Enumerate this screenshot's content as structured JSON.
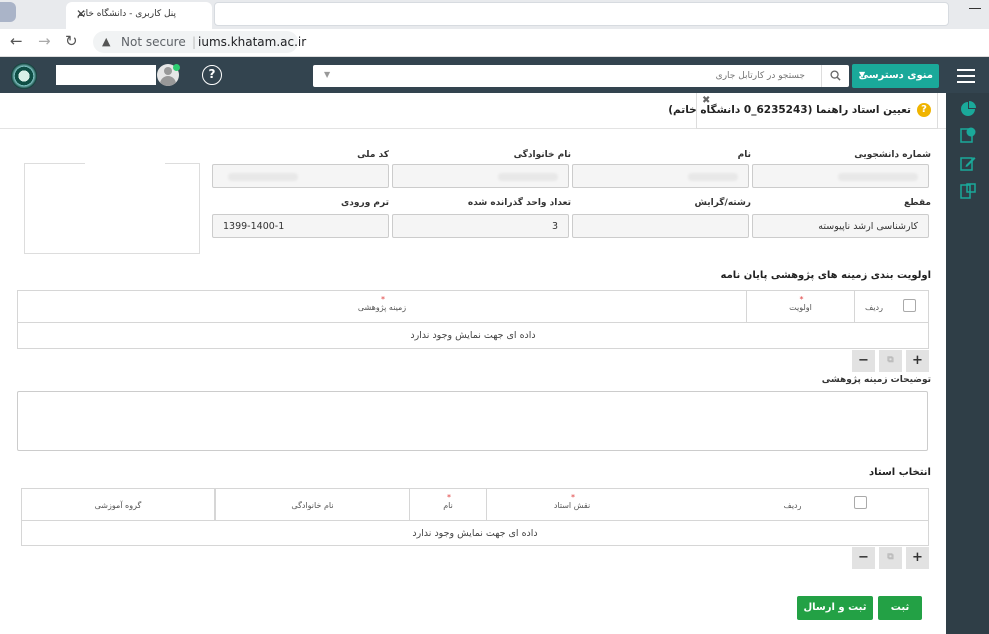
{
  "browser": {
    "tab_title": "پنل کاربری - دانشگاه خاتم",
    "tab_close": "✕",
    "not_secure": "Not secure",
    "url": "iums.khatam.ac.ir",
    "back": "←",
    "forward": "→",
    "reload": "↻",
    "menu": "⋮"
  },
  "header": {
    "search_placeholder": "جستجو در کارتابل جاری",
    "access_menu_label": "منوی دسترسی",
    "help": "?",
    "accent_color": "#1aa99a",
    "bar_color": "#33444f"
  },
  "page_tab": {
    "title": "تعیین استاد راهنما (6235243_0 دانشگاه خاتم)",
    "help": "?",
    "close": "✖"
  },
  "form": {
    "student_number_label": "شماره دانشجویی",
    "first_name_label": "نام",
    "last_name_label": "نام خانوادگی",
    "national_id_label": "کد ملی",
    "degree_label": "مقطع",
    "degree_value": "کارشناسی ارشد ناپیوسته",
    "field_label": "رشته/گرایش",
    "units_passed_label": "تعداد واحد گذرانده شده",
    "units_passed_value": "3",
    "entry_term_label": "ترم ورودی",
    "entry_term_value": "1399-1400-1"
  },
  "research_priority": {
    "title": "اولویت بندی زمینه های پژوهشی پایان نامه",
    "col_row": "ردیف",
    "col_priority": "اولویت",
    "col_field": "زمینه پژوهشی",
    "empty_text": "داده ای جهت نمایش وجود ندارد",
    "add": "+",
    "remove": "−",
    "copy": "⧉"
  },
  "research_description": {
    "label": "توضیحات زمینه پژوهشی"
  },
  "professor_select": {
    "title": "انتخاب استاد",
    "col_row": "ردیف",
    "col_role": "نقش استاد",
    "col_first_name": "نام",
    "col_last_name": "نام خانوادگی",
    "col_department": "گروه آموزشی",
    "empty_text": "داده ای جهت نمایش وجود ندارد",
    "add": "+",
    "remove": "−",
    "copy": "⧉"
  },
  "actions": {
    "save": "ثبت",
    "save_and_send": "ثبت و ارسال",
    "button_color": "#23a145"
  },
  "sidebar_icons": [
    "pie-chart-icon",
    "clock-document-icon",
    "edit-icon",
    "transfer-icon"
  ]
}
